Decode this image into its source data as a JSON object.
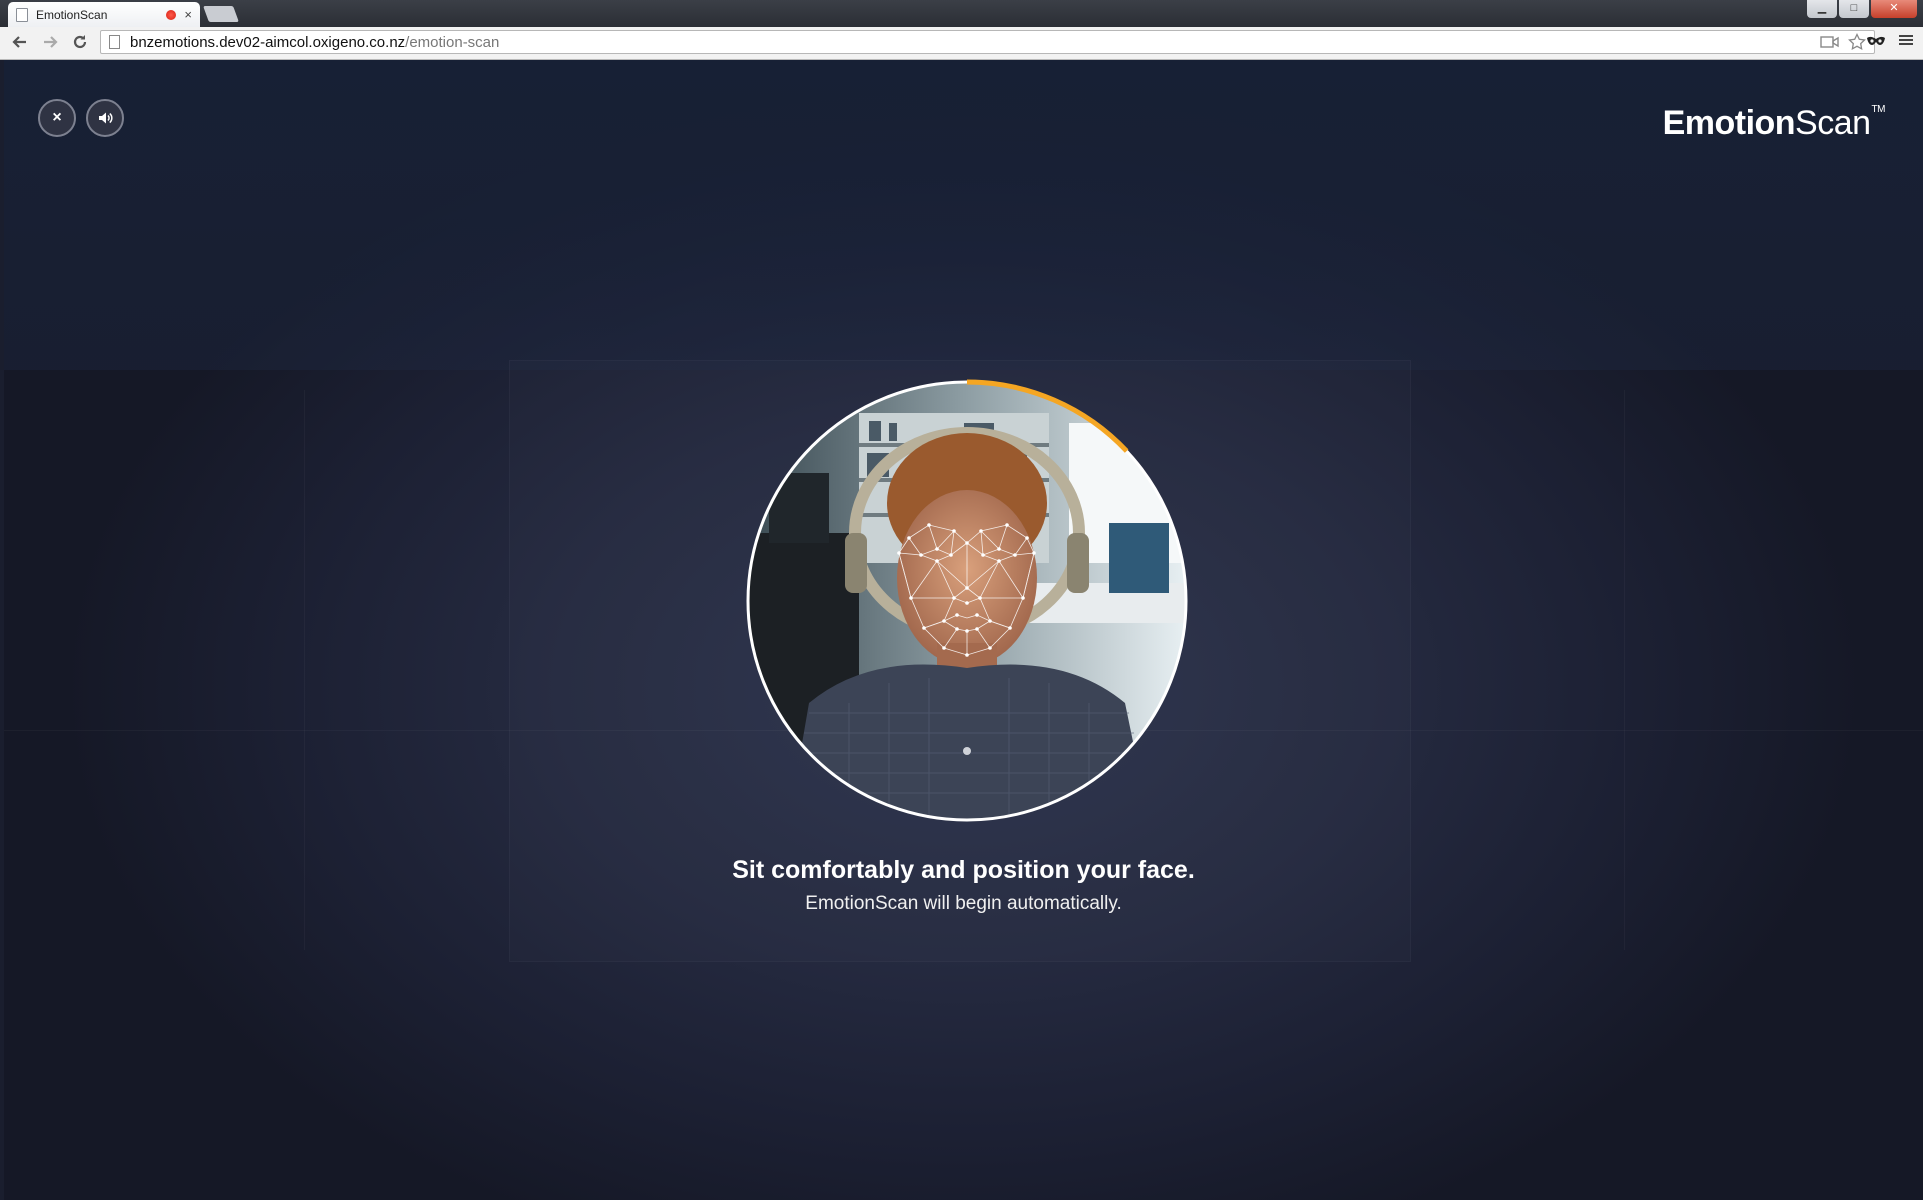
{
  "browser": {
    "tab_title": "EmotionScan",
    "tab_close": "×",
    "window_controls": {
      "minimize": "▁",
      "maximize": "□",
      "close": "✕"
    },
    "url_host": "bnzemotions.dev02-aimcol.oxigeno.co.nz",
    "url_path": "/emotion-scan",
    "icons": {
      "back": "back-arrow-icon",
      "forward": "forward-arrow-icon",
      "reload": "reload-icon",
      "page": "page-icon",
      "camera": "camera-icon",
      "bookmark": "star-icon",
      "extension": "mask-icon",
      "menu": "hamburger-menu-icon"
    }
  },
  "app": {
    "close_button": "×",
    "sound_button": "speaker-icon",
    "logo_bold": "Emotion",
    "logo_light": "Scan",
    "logo_tm": "TM",
    "scan_progress": 0.13,
    "accent_color": "#f5a623",
    "prompt_title": "Sit comfortably and position your face.",
    "prompt_subtitle": "EmotionScan will begin automatically."
  }
}
